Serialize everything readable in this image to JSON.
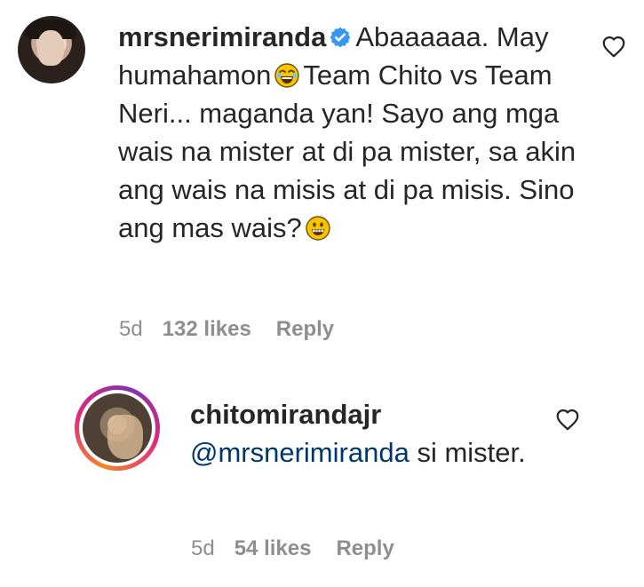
{
  "comment": {
    "username": "mrsnerimiranda",
    "text_before_emoji": "Abaaaaaa. May humahamon",
    "text_middle": "Team Chito vs Team Neri... maganda yan! Sayo ang mga wais na mister at di pa mister, sa akin ang wais na misis at di pa misis. Sino ang mas wais?",
    "emoji_1": "face-with-tears-of-joy",
    "emoji_2": "grinning-face",
    "time": "5d",
    "likes": "132 likes",
    "reply_label": "Reply",
    "verified": true
  },
  "reply": {
    "username": "chitomirandajr",
    "mention": "@mrsnerimiranda",
    "text": "si mister.",
    "time": "5d",
    "likes": "54 likes",
    "reply_label": "Reply"
  },
  "icons": {
    "like": "heart-outline-icon",
    "verified": "verified-badge-icon"
  },
  "colors": {
    "text": "#262626",
    "meta": "#8e8e8e",
    "mention": "#00376b",
    "verified": "#3897f0"
  }
}
